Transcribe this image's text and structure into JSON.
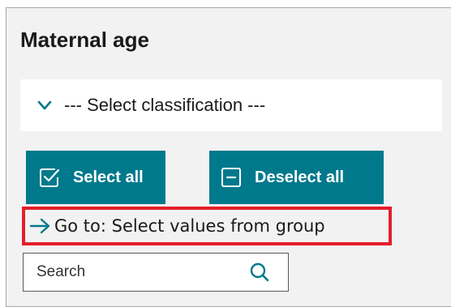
{
  "panel": {
    "title": "Maternal age"
  },
  "classification": {
    "label": "--- Select classification ---",
    "icon": "chevron-down-icon"
  },
  "buttons": {
    "select_all": "Select all",
    "deselect_all": "Deselect all",
    "select_icon": "checkbox-checked-icon",
    "deselect_icon": "checkbox-minus-icon"
  },
  "goto": {
    "label": "Go to: Select values from group",
    "icon": "arrow-right-icon"
  },
  "search": {
    "placeholder": "Search",
    "icon": "search-icon"
  },
  "colors": {
    "accent": "#00798c",
    "highlight_border": "#e41e2b",
    "panel_bg": "#f2f2f2"
  }
}
